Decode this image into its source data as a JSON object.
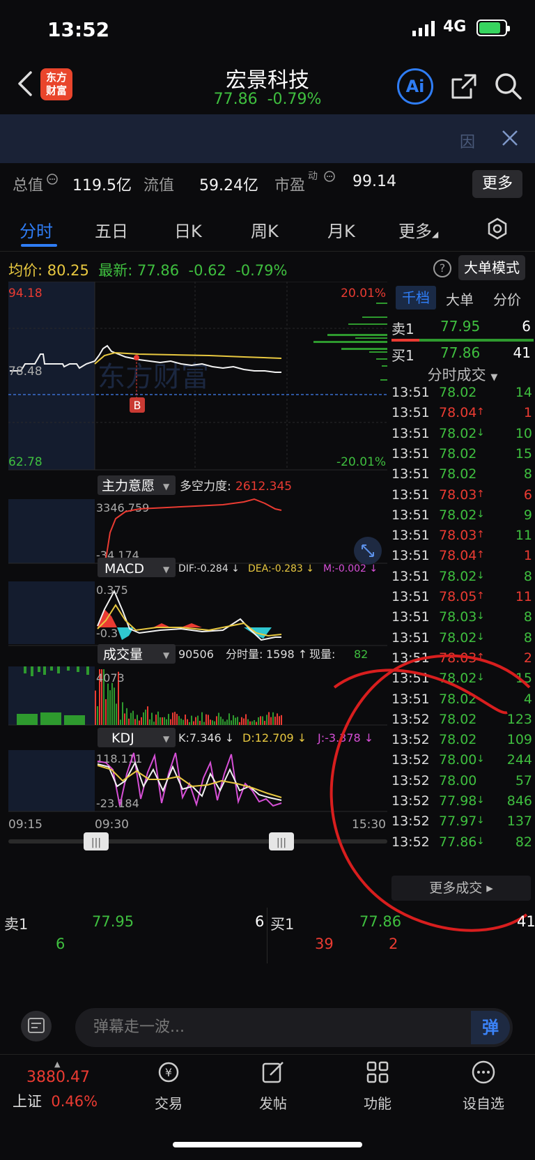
{
  "status_bar": {
    "time": "13:52",
    "network": "4G"
  },
  "header": {
    "logo_text": "东方财富",
    "title": "宏景科技",
    "price": "77.86",
    "change_pct": "-0.79%",
    "ai_label": "Ai"
  },
  "banner": {
    "icon_text": "因"
  },
  "stats": {
    "total_value_label": "总值",
    "total_value": "119.5亿",
    "float_value_label": "流值",
    "float_value": "59.24亿",
    "pe_label": "市盈",
    "pe_sup": "动",
    "pe_value": "99.14",
    "more_label": "更多"
  },
  "tabs": [
    "分时",
    "五日",
    "日K",
    "周K",
    "月K",
    "更多"
  ],
  "price_line": {
    "avg_label": "均价:",
    "avg_value": "80.25",
    "latest_label": "最新:",
    "latest_value": "77.86",
    "change": "-0.62",
    "change_pct": "-0.79%",
    "big_order_mode": "大单模式"
  },
  "chart": {
    "price_high": "94.18",
    "price_low": "62.78",
    "pct_high": "20.01%",
    "pct_low": "-20.01%",
    "prev_close": "78.48",
    "buy_marker": "B",
    "watermark": "东方财富",
    "main_force_label": "主力意愿",
    "bull_bear_label": "多空力度:",
    "bull_bear_value": "2612.345",
    "main_force_high": "3346.759",
    "main_force_low": "-34.174",
    "macd_label": "MACD",
    "dif": "DIF:-0.284 ↓",
    "dea": "DEA:-0.283 ↓",
    "m": "M:-0.002 ↓",
    "macd_high": "0.375",
    "macd_low": "-0.3",
    "volume_label": "成交量",
    "volume_total": "90506",
    "volume_min_label": "分时量:",
    "volume_min": "1598 ↑",
    "volume_now_label": "现量:",
    "volume_now": "82",
    "volume_high": "4073",
    "kdj_label": "KDJ",
    "k": "K:7.346 ↓",
    "d": "D:12.709 ↓",
    "j": "J:-3.378 ↓",
    "kdj_high": "118.111",
    "kdj_low": "-23.184",
    "time_start": "09:15",
    "time_open": "09:30",
    "time_end": "15:30"
  },
  "right_tabs": [
    "千档",
    "大单",
    "分价"
  ],
  "order_book": {
    "sell1_label": "卖1",
    "sell1_price": "77.95",
    "sell1_vol": "6",
    "buy1_label": "买1",
    "buy1_price": "77.86",
    "buy1_vol": "41"
  },
  "trades_header": "分时成交",
  "trades": [
    {
      "time": "13:51",
      "price": "78.02",
      "arrow": "",
      "vol": "14",
      "color": "green"
    },
    {
      "time": "13:51",
      "price": "78.04",
      "arrow": "↑",
      "vol": "1",
      "color": "red"
    },
    {
      "time": "13:51",
      "price": "78.02",
      "arrow": "↓",
      "vol": "10",
      "color": "green"
    },
    {
      "time": "13:51",
      "price": "78.02",
      "arrow": "",
      "vol": "15",
      "color": "green"
    },
    {
      "time": "13:51",
      "price": "78.02",
      "arrow": "",
      "vol": "8",
      "color": "green"
    },
    {
      "time": "13:51",
      "price": "78.03",
      "arrow": "↑",
      "vol": "6",
      "color": "red"
    },
    {
      "time": "13:51",
      "price": "78.02",
      "arrow": "↓",
      "vol": "9",
      "color": "green"
    },
    {
      "time": "13:51",
      "price": "78.03",
      "arrow": "↑",
      "vol": "11",
      "color": "green"
    },
    {
      "time": "13:51",
      "price": "78.04",
      "arrow": "↑",
      "vol": "1",
      "color": "red"
    },
    {
      "time": "13:51",
      "price": "78.02",
      "arrow": "↓",
      "vol": "8",
      "color": "green"
    },
    {
      "time": "13:51",
      "price": "78.05",
      "arrow": "↑",
      "vol": "11",
      "color": "red"
    },
    {
      "time": "13:51",
      "price": "78.03",
      "arrow": "↓",
      "vol": "8",
      "color": "green"
    },
    {
      "time": "13:51",
      "price": "78.02",
      "arrow": "↓",
      "vol": "8",
      "color": "green"
    },
    {
      "time": "13:51",
      "price": "78.03",
      "arrow": "↑",
      "vol": "2",
      "color": "red"
    },
    {
      "time": "13:51",
      "price": "78.02",
      "arrow": "↓",
      "vol": "15",
      "color": "green"
    },
    {
      "time": "13:51",
      "price": "78.02",
      "arrow": "",
      "vol": "4",
      "color": "green"
    },
    {
      "time": "13:52",
      "price": "78.02",
      "arrow": "",
      "vol": "123",
      "color": "green"
    },
    {
      "time": "13:52",
      "price": "78.02",
      "arrow": "",
      "vol": "109",
      "color": "green"
    },
    {
      "time": "13:52",
      "price": "78.00",
      "arrow": "↓",
      "vol": "244",
      "color": "green"
    },
    {
      "time": "13:52",
      "price": "78.00",
      "arrow": "",
      "vol": "57",
      "color": "green"
    },
    {
      "time": "13:52",
      "price": "77.98",
      "arrow": "↓",
      "vol": "846",
      "color": "green"
    },
    {
      "time": "13:52",
      "price": "77.97",
      "arrow": "↓",
      "vol": "137",
      "color": "green"
    },
    {
      "time": "13:52",
      "price": "77.86",
      "arrow": "↓",
      "vol": "82",
      "color": "green"
    }
  ],
  "more_trades": "更多成交 ▸",
  "book_row": {
    "sell_label": "卖1",
    "sell_price": "77.95",
    "sell_vol": "6",
    "sell_count": "6",
    "buy_label": "买1",
    "buy_price": "77.86",
    "buy_vol": "41",
    "buy_count_a": "39",
    "buy_count_b": "2"
  },
  "danmu": {
    "placeholder": "弹幕走一波...",
    "button": "弹"
  },
  "nav": {
    "index_value": "3880.47",
    "index_name": "上证",
    "index_change": "0.46%",
    "items": [
      "交易",
      "发帖",
      "功能",
      "设自选"
    ]
  },
  "colors": {
    "up": "#ea3b32",
    "down": "#3fbf3f",
    "accent": "#2f7df5",
    "avg_line": "#e8c840"
  }
}
